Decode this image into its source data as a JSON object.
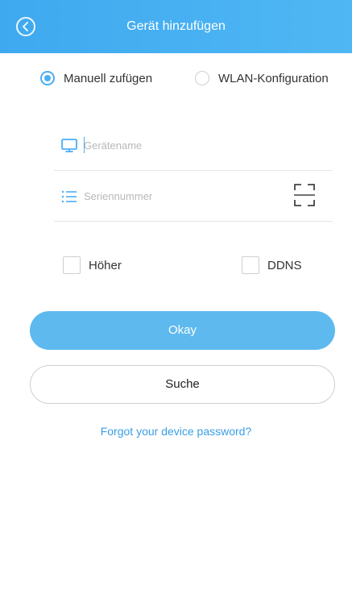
{
  "header": {
    "title": "Gerät hinzufügen",
    "background": "#4aaef3"
  },
  "mode": {
    "options": [
      {
        "label": "Manuell zufügen",
        "selected": true
      },
      {
        "label": "WLAN-Konfiguration",
        "selected": false
      }
    ]
  },
  "form": {
    "device_name_placeholder": "Gerätename",
    "serial_placeholder": "Seriennummer"
  },
  "options": {
    "advanced_label": "Höher",
    "ddns_label": "DDNS"
  },
  "actions": {
    "okay_label": "Okay",
    "search_label": "Suche"
  },
  "links": {
    "forgot_password": "Forgot your device password?"
  },
  "colors": {
    "accent": "#4aaef3",
    "link": "#3a9ee6"
  },
  "icons": {
    "back": "back-arrow-icon",
    "device_name": "monitor-icon",
    "serial": "list-icon",
    "scan": "qr-scan-icon"
  }
}
